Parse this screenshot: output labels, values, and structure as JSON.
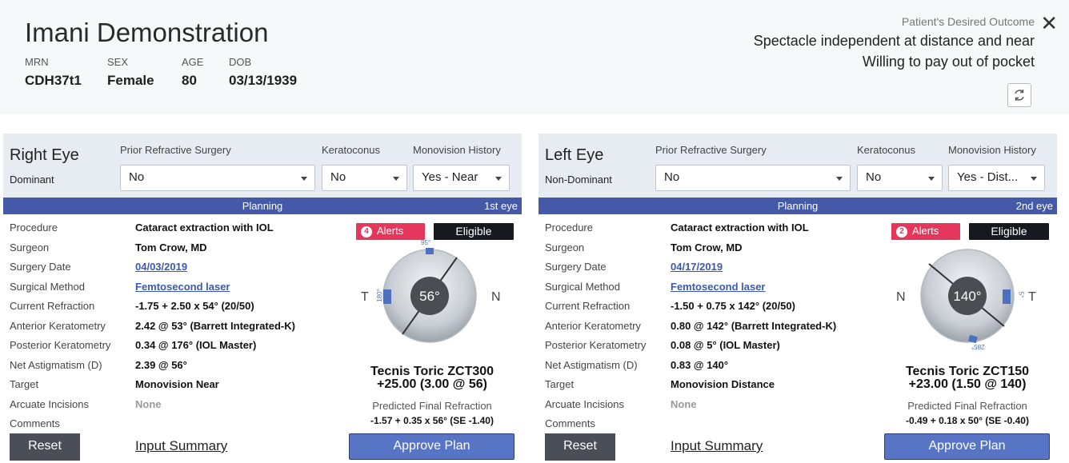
{
  "header": {
    "patient_name": "Imani Demonstration",
    "demographics": [
      {
        "label": "MRN",
        "value": "CDH37t1"
      },
      {
        "label": "SEX",
        "value": "Female"
      },
      {
        "label": "AGE",
        "value": "80"
      },
      {
        "label": "DOB",
        "value": "03/13/1939"
      }
    ],
    "outcome_label": "Patient's Desired Outcome",
    "outcome_lines": [
      "Spectacle independent at distance and near",
      "Willing to pay out of pocket"
    ],
    "close_icon": "close-icon",
    "refresh_icon": "refresh-icon"
  },
  "colors": {
    "planning_bar": "#4459a8",
    "alerts": "#e5375b",
    "eligible": "#16191f",
    "approve": "#5775c4",
    "link": "#3a59b0"
  },
  "eyes": [
    {
      "title": "Right Eye",
      "dominance": "Dominant",
      "prior_surgery_label": "Prior Refractive Surgery",
      "prior_surgery": "No",
      "keratoconus_label": "Keratoconus",
      "keratoconus": "No",
      "monovision_label": "Monovision History",
      "monovision": "Yes - Near",
      "planning_label": "Planning",
      "eye_order": "1st eye",
      "rows": [
        {
          "label": "Procedure",
          "value": "Cataract extraction with IOL"
        },
        {
          "label": "Surgeon",
          "value": "Tom Crow, MD"
        },
        {
          "label": "Surgery Date",
          "value": "04/03/2019"
        },
        {
          "label": "Surgical Method",
          "value": "Femtosecond laser"
        },
        {
          "label": "Current Refraction",
          "value": "-1.75 + 2.50 x 54° (20/50)"
        },
        {
          "label": "Anterior Keratometry",
          "value": "2.42 @ 53° (Barrett Integrated-K)"
        },
        {
          "label": "Posterior Keratometry",
          "value": "0.34 @ 176° (IOL Master)"
        },
        {
          "label": "Net Astigmatism (D)",
          "value": "2.39 @ 56°"
        },
        {
          "label": "Target",
          "value": "Monovision Near"
        },
        {
          "label": "Arcuate Incisions",
          "value": "None"
        },
        {
          "label": "Comments",
          "value": ""
        }
      ],
      "alerts_count": "4",
      "alerts_label": "Alerts",
      "eligible_label": "Eligible",
      "dial": {
        "axis_label": "56°",
        "axis_deg": 56,
        "left_side": "T",
        "right_side": "N",
        "marker_top": "95°",
        "marker_side": "180°"
      },
      "lens_name": "Tecnis Toric ZCT300",
      "lens_power": "+25.00 (3.00 @ 56)",
      "pred_label": "Predicted Final Refraction",
      "pred_value": "-1.57 + 0.35 x 56° (SE -1.40)",
      "reset_label": "Reset",
      "summary_label": "Input Summary",
      "approve_label": "Approve Plan"
    },
    {
      "title": "Left Eye",
      "dominance": "Non-Dominant",
      "prior_surgery_label": "Prior Refractive Surgery",
      "prior_surgery": "No",
      "keratoconus_label": "Keratoconus",
      "keratoconus": "No",
      "monovision_label": "Monovision History",
      "monovision": "Yes - Dist...",
      "planning_label": "Planning",
      "eye_order": "2nd eye",
      "rows": [
        {
          "label": "Procedure",
          "value": "Cataract extraction with IOL"
        },
        {
          "label": "Surgeon",
          "value": "Tom Crow, MD"
        },
        {
          "label": "Surgery Date",
          "value": "04/17/2019"
        },
        {
          "label": "Surgical Method",
          "value": "Femtosecond laser"
        },
        {
          "label": "Current Refraction",
          "value": "-1.50 + 0.75 x 142° (20/50)"
        },
        {
          "label": "Anterior Keratometry",
          "value": "0.80 @ 142° (Barrett Integrated-K)"
        },
        {
          "label": "Posterior Keratometry",
          "value": "0.08 @ 5° (IOL Master)"
        },
        {
          "label": "Net Astigmatism (D)",
          "value": "0.83 @ 140°"
        },
        {
          "label": "Target",
          "value": "Monovision Distance"
        },
        {
          "label": "Arcuate Incisions",
          "value": "None"
        },
        {
          "label": "Comments",
          "value": ""
        }
      ],
      "alerts_count": "2",
      "alerts_label": "Alerts",
      "eligible_label": "Eligible",
      "dial": {
        "axis_label": "140°",
        "axis_deg": 140,
        "left_side": "N",
        "right_side": "T",
        "marker_top": "285°",
        "marker_side": "5°"
      },
      "lens_name": "Tecnis Toric ZCT150",
      "lens_power": "+23.00 (1.50 @ 140)",
      "pred_label": "Predicted Final Refraction",
      "pred_value": "-0.49 + 0.18 x 50° (SE -0.40)",
      "reset_label": "Reset",
      "summary_label": "Input Summary",
      "approve_label": "Approve Plan"
    }
  ]
}
